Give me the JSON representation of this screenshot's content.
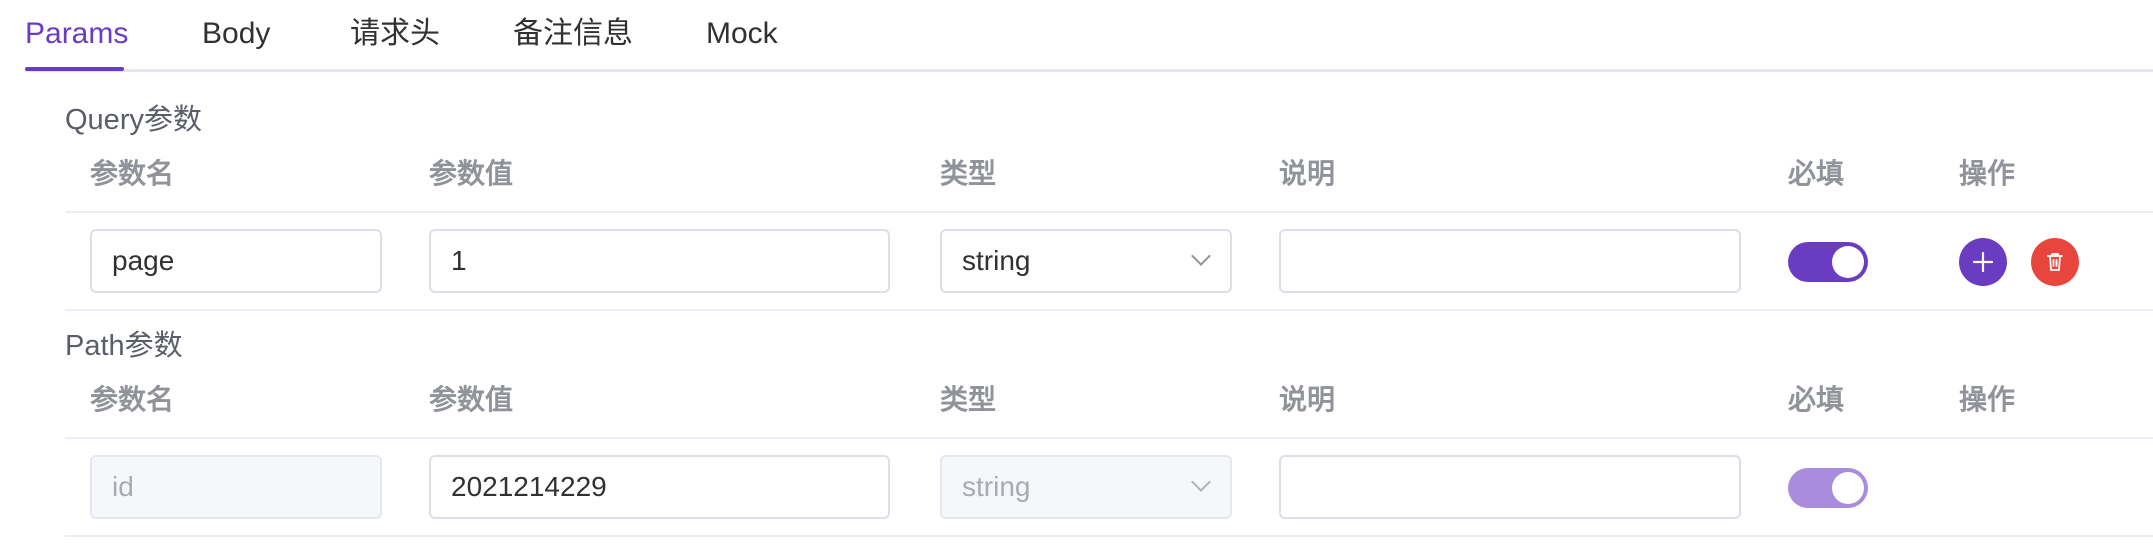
{
  "tabs": [
    {
      "label": "Params",
      "active": true
    },
    {
      "label": "Body"
    },
    {
      "label": "请求头"
    },
    {
      "label": "备注信息"
    },
    {
      "label": "Mock"
    }
  ],
  "columns": {
    "name": "参数名",
    "value": "参数值",
    "type": "类型",
    "desc": "说明",
    "required": "必填",
    "actions": "操作"
  },
  "query": {
    "title": "Query参数",
    "rows": [
      {
        "name": "page",
        "value": "1",
        "type": "string",
        "desc": "",
        "required": true
      }
    ]
  },
  "path": {
    "title": "Path参数",
    "rows": [
      {
        "name_placeholder": "id",
        "value": "2021214229",
        "type": "string",
        "desc": "",
        "required": true
      }
    ]
  },
  "colors": {
    "accent": "#6a3cc2",
    "accent_disabled": "#a98ddc",
    "danger": "#e8453c"
  },
  "icons": {
    "add": "plus-icon",
    "delete": "trash-icon",
    "select": "chevron-down-icon"
  }
}
